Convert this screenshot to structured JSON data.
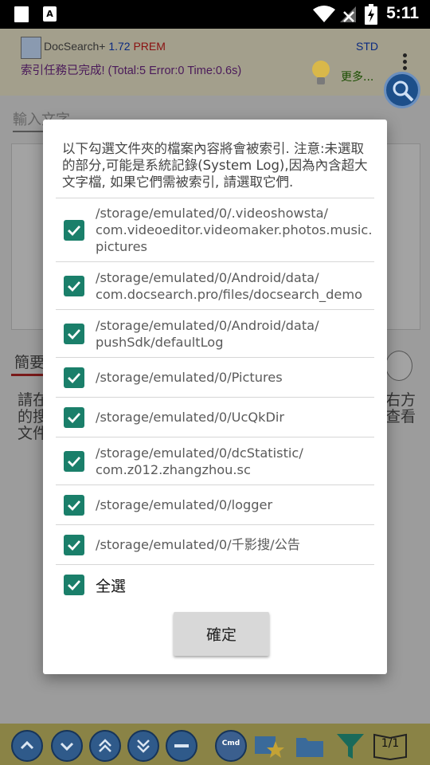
{
  "status_bar": {
    "time": "5:11",
    "icons": [
      "notification-square-icon",
      "font-a-icon",
      "wifi-icon",
      "signal-off-icon",
      "battery-charging-icon"
    ]
  },
  "app": {
    "name": "DocSearch+",
    "version": "1.72",
    "edition": "PREM",
    "mode": "STD",
    "index_status": "索引任務已完成!  (Total:5 Error:0 Time:0.6s)",
    "more_label": "更多...",
    "search_placeholder": "輸入文字",
    "summary_tab": "簡要",
    "bg_lines_left": [
      "請在",
      "的搜",
      "文件"
    ],
    "bg_lines_right": [
      "右方",
      "查看"
    ]
  },
  "dialog": {
    "message": "以下勾選文件夾的檔案內容將會被索引. 注意:未選取的部分,可能是系統記錄(System Log),因為內含超大文字檔, 如果它們需被索引, 請選取它們.",
    "folders": [
      {
        "path": "/storage/emulated/0/.videoshowsta/\ncom.videoeditor.videomaker.photos.music.\npictures",
        "checked": true
      },
      {
        "path": "/storage/emulated/0/Android/data/\ncom.docsearch.pro/files/docsearch_demo",
        "checked": true
      },
      {
        "path": "/storage/emulated/0/Android/data/\npushSdk/defaultLog",
        "checked": true
      },
      {
        "path": "/storage/emulated/0/Pictures",
        "checked": true
      },
      {
        "path": "/storage/emulated/0/UcQkDir",
        "checked": true
      },
      {
        "path": "/storage/emulated/0/dcStatistic/\ncom.z012.zhangzhou.sc",
        "checked": true
      },
      {
        "path": "/storage/emulated/0/logger",
        "checked": true
      },
      {
        "path": "/storage/emulated/0/千影搜/公告",
        "checked": true
      }
    ],
    "select_all_label": "全選",
    "select_all_checked": true,
    "ok_label": "確定"
  },
  "toolbar": {
    "cmd_label": "Cmd",
    "page_indicator": "1/1"
  },
  "colors": {
    "checkbox": "#1a7f6a",
    "scrim": "#9c9c9c",
    "dialog_bg": "#ffffff",
    "toolbar_bg": "#8a8346"
  }
}
